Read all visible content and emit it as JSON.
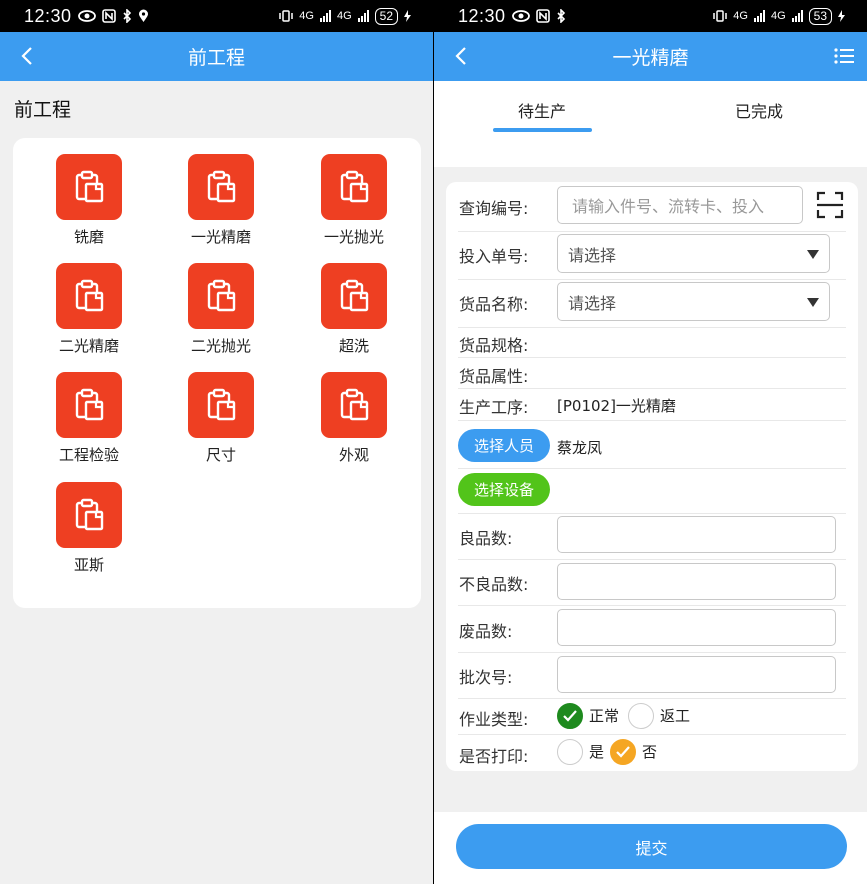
{
  "left": {
    "status": {
      "time": "12:30",
      "battery": "52",
      "network_1": "4G",
      "network_2": "4G"
    },
    "header": {
      "title": "前工程"
    },
    "section_title": "前工程",
    "tiles": [
      {
        "label": "铣磨"
      },
      {
        "label": "一光精磨"
      },
      {
        "label": "一光抛光"
      },
      {
        "label": "二光精磨"
      },
      {
        "label": "二光抛光"
      },
      {
        "label": "超洗"
      },
      {
        "label": "工程检验"
      },
      {
        "label": "尺寸"
      },
      {
        "label": "外观"
      },
      {
        "label": "亚斯"
      }
    ],
    "tile_icon": "clipboard-icon",
    "tile_color": "#ee3f22"
  },
  "right": {
    "status": {
      "time": "12:30",
      "battery": "53",
      "network_1": "4G",
      "network_2": "4G"
    },
    "header": {
      "title": "一光精磨"
    },
    "tabs": [
      {
        "label": "待生产"
      },
      {
        "label": "已完成"
      }
    ],
    "active_tab": "待生产",
    "form": {
      "query_label": "查询编号:",
      "query_placeholder": "请输入件号、流转卡、投入",
      "order_label": "投入单号:",
      "order_value": "请选择",
      "goods_name_label": "货品名称:",
      "goods_name_value": "请选择",
      "goods_spec_label": "货品规格:",
      "goods_attr_label": "货品属性:",
      "process_label": "生产工序:",
      "process_value": "[P0102]一光精磨",
      "select_staff_button": "选择人员",
      "staff_value": "蔡龙凤",
      "select_device_button": "选择设备",
      "good_qty_label": "良品数:",
      "bad_qty_label": "不良品数:",
      "scrap_qty_label": "废品数:",
      "batch_label": "批次号:",
      "job_type_label": "作业类型:",
      "job_type_options": [
        "正常",
        "返工"
      ],
      "job_type_selected": "正常",
      "print_label": "是否打印:",
      "print_options": [
        "是",
        "否"
      ],
      "print_selected": "否"
    },
    "submit_label": "提交"
  },
  "colors": {
    "primary": "#3c9cf0",
    "tile_red": "#ee3f22",
    "device_green": "#52c41a",
    "radio_green": "#1e8a1e",
    "radio_orange": "#f5a623"
  }
}
